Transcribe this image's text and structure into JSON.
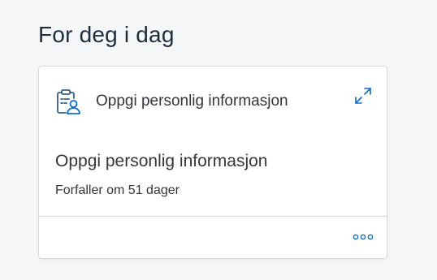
{
  "section": {
    "title": "For deg i dag"
  },
  "card": {
    "header_title": "Oppgi personlig informasjon",
    "header_icon": "clipboard-person-icon",
    "expand_icon": "expand-icon",
    "task_title": "Oppgi personlig informasjon",
    "task_subtitle": "Forfaller om 51 dager",
    "more_icon": "more-options-icon"
  },
  "colors": {
    "background": "#f5f6f7",
    "title_text": "#1d2d3e",
    "body_text": "#32363a",
    "icon_blue": "#0a6ed1",
    "icon_dark_blue": "#346187"
  }
}
